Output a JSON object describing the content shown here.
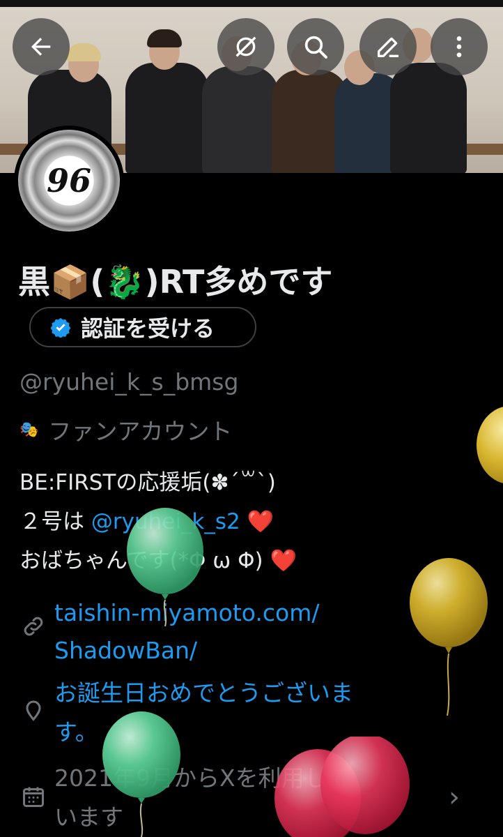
{
  "header": {
    "back_icon": "arrow-left-icon",
    "actions": [
      "no-bell-icon",
      "search-icon",
      "edit-icon",
      "more-vertical-icon"
    ]
  },
  "profile": {
    "avatar_text": "96",
    "display_name": "黒📦(🐉)RT多めです",
    "verify_label": "認証を受ける",
    "handle": "@ryuhei_k_s_bmsg",
    "category": "ファンアカウント",
    "bio": {
      "line1": "BE:FIRSTの応援垢(✽´꒳`)",
      "line2_prefix": "２号は ",
      "line2_mention": "@ryuhei_k_s2",
      "line2_emoji": "❤️",
      "line3_text": "おばちゃんです(*Φ ω Φ)",
      "line3_emoji": "❤️"
    },
    "link_line1": "taishin-miyamoto.com/",
    "link_line2": "ShadowBan/",
    "location_line1": "お誕生日おめでとうございま",
    "location_line2": "す。",
    "joined_line1": "2021年9月からXを利用して",
    "joined_line2": "います"
  },
  "colors": {
    "background": "#000000",
    "text": "#e7e9ea",
    "muted": "#71767b",
    "accent": "#1d9bf0",
    "balloon_green": "#5fd29a",
    "balloon_yellow": "#d9b62e",
    "balloon_pink": "#e8375c"
  }
}
